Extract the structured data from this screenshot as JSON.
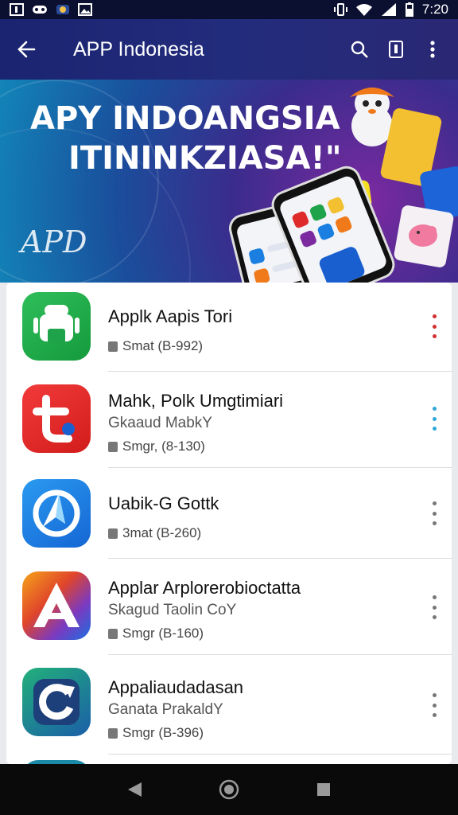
{
  "status": {
    "time": "7:20",
    "color": "#0c1030"
  },
  "toolbar": {
    "title": "APP Indonesia",
    "color": "#1f2878"
  },
  "banner": {
    "headline_1": "APY INDOANGSIA",
    "headline_2": "ITININKZIASA!\"",
    "logo_text": "APD"
  },
  "apps": [
    {
      "name": "Applk Aapis Tori",
      "subtitle": "",
      "meta": "Smat (B-992)",
      "icon": "android-icon",
      "icon_color": "#1fa34a",
      "menu_color": "#d32f2f"
    },
    {
      "name": "Mahk, Polk Umgtimiari",
      "subtitle": "Gkaaud MabkY",
      "meta": "Smgr, (8-130)",
      "icon": "t-logo-icon",
      "icon_color": "#e02b2b",
      "menu_color": "#2ea8d8"
    },
    {
      "name": "Uabik-G Gottk",
      "subtitle": "",
      "meta": "3mat (B-260)",
      "icon": "paper-plane-icon",
      "icon_color": "#1a7fe0",
      "menu_color": "#777777"
    },
    {
      "name": "Applar Arplorerobioctatta",
      "subtitle": "Skagud Taolin CoY",
      "meta": "Smgr (B-160)",
      "icon": "a-logo-icon",
      "icon_color": "#e06a1a",
      "menu_color": "#777777"
    },
    {
      "name": "Appaliaudadasan",
      "subtitle": "Ganata PrakaldY",
      "meta": "Smgr (B-396)",
      "icon": "refresh-logo-icon",
      "icon_color": "#1d8a7a",
      "menu_color": "#777777"
    }
  ]
}
